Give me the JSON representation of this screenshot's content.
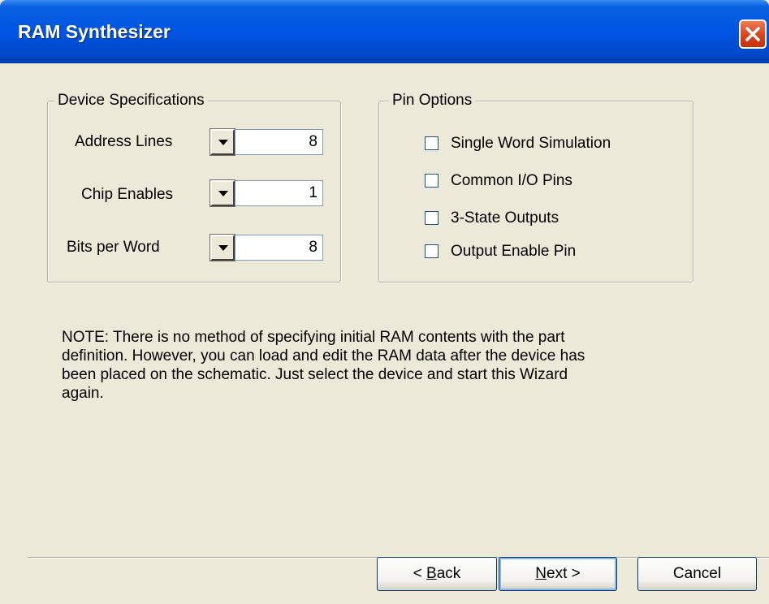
{
  "window": {
    "title": "RAM Synthesizer"
  },
  "device_specs": {
    "legend": "Device Specifications",
    "fields": [
      {
        "label": "Address Lines",
        "value": "8"
      },
      {
        "label": "Chip Enables",
        "value": "1"
      },
      {
        "label": "Bits per Word",
        "value": "8"
      }
    ]
  },
  "pin_options": {
    "legend": "Pin Options",
    "checkboxes": [
      {
        "label": "Single Word Simulation",
        "checked": false
      },
      {
        "label": "Common I/O Pins",
        "checked": false
      },
      {
        "label": "3-State Outputs",
        "checked": false
      },
      {
        "label": "Output Enable Pin",
        "checked": false
      }
    ]
  },
  "note": "NOTE: There is no method of specifying initial RAM contents with the part definition.  However, you can load and edit the RAM data after the device has been placed on the schematic.  Just select the device and start this Wizard again.",
  "buttons": {
    "back": {
      "mnemonic": "B",
      "rest": "ack",
      "prefix": "< "
    },
    "next": {
      "mnemonic": "N",
      "rest": "ext >"
    },
    "cancel": "Cancel"
  },
  "icons": {
    "close": "close-icon",
    "dropdown": "chevron-down-icon"
  },
  "colors": {
    "titlebar": "#0054e3",
    "dialog_bg": "#ece9d8",
    "close_button": "#d8401a"
  }
}
